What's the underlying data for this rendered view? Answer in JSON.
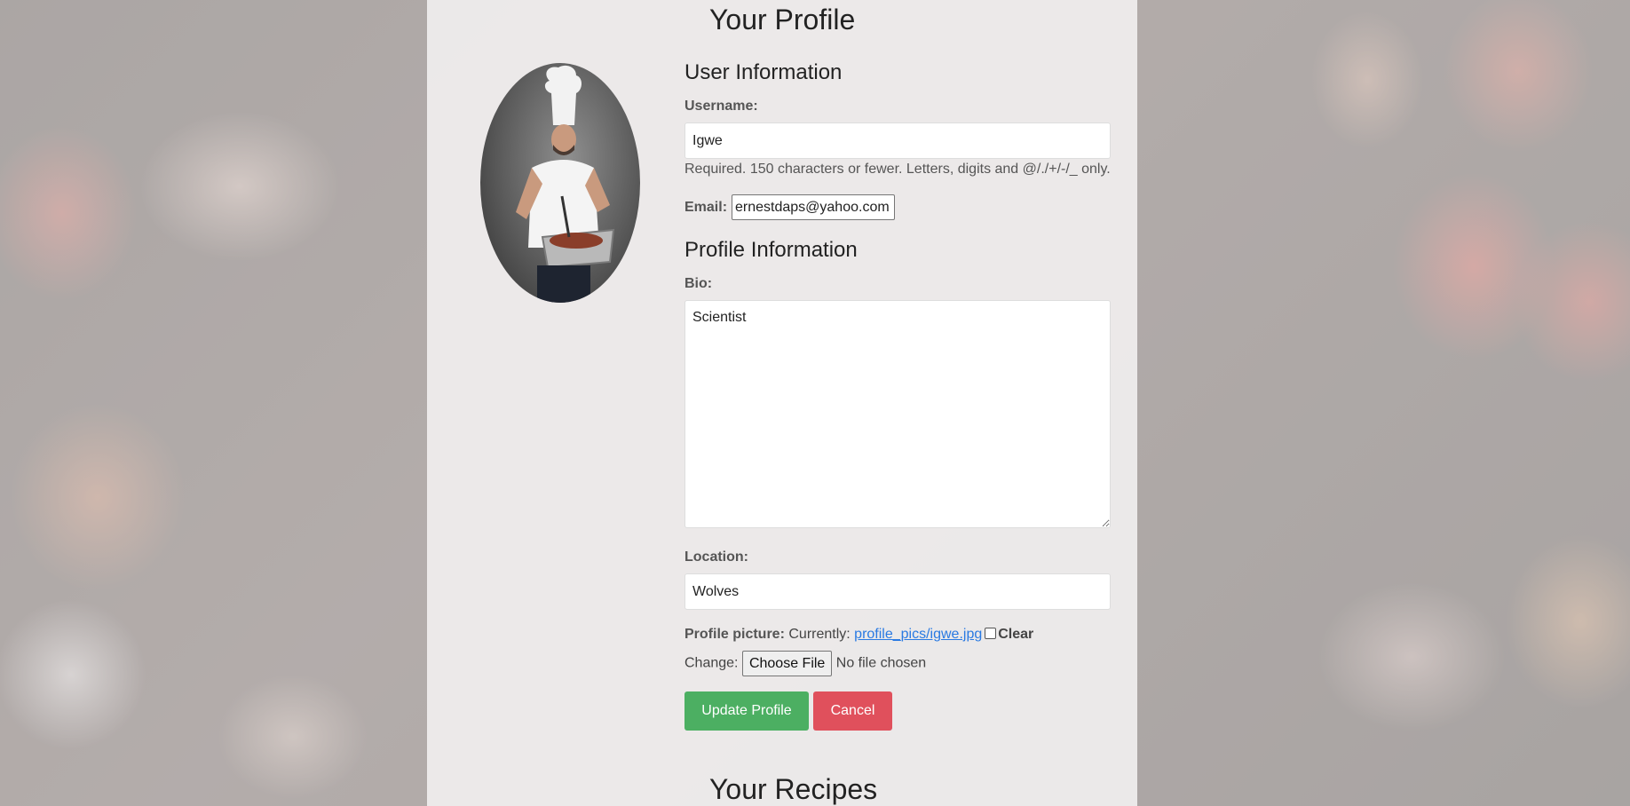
{
  "page": {
    "title": "Your Profile",
    "recipes_heading": "Your Recipes"
  },
  "user_info": {
    "heading": "User Information",
    "username_label": "Username:",
    "username_value": "Igwe",
    "username_help": "Required. 150 characters or fewer. Letters, digits and @/./+/-/_ only.",
    "email_label": "Email:",
    "email_value": "ernestdaps@yahoo.com"
  },
  "profile_info": {
    "heading": "Profile Information",
    "bio_label": "Bio:",
    "bio_value": "Scientist",
    "location_label": "Location:",
    "location_value": "Wolves",
    "picture_label": "Profile picture:",
    "currently_label": "Currently:",
    "current_picture": "profile_pics/igwe.jpg",
    "clear_label": "Clear",
    "change_label": "Change:",
    "choose_file_label": "Choose File",
    "no_file_label": "No file chosen"
  },
  "actions": {
    "update_label": "Update Profile",
    "cancel_label": "Cancel"
  },
  "colors": {
    "success": "#4caf62",
    "danger": "#e0505c",
    "link": "#2a7ae2"
  },
  "icons": {
    "avatar": "chef-photo"
  }
}
